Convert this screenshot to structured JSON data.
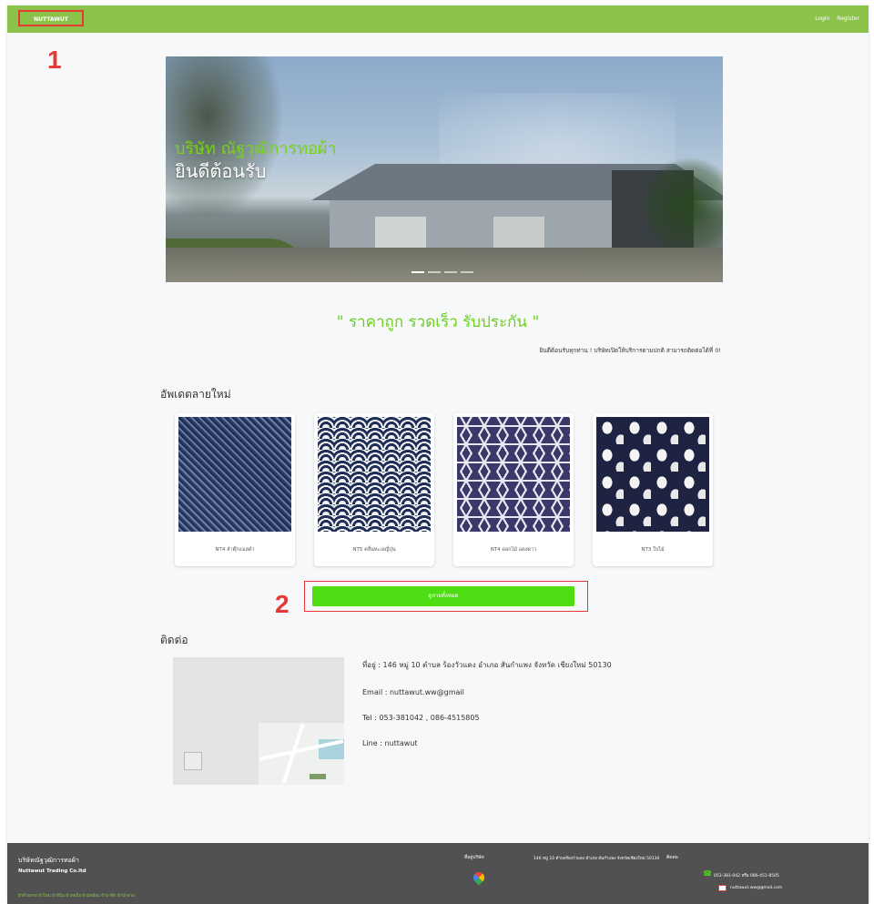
{
  "navbar": {
    "brand": "NUTTAWUT",
    "login": "Login",
    "register": "Register"
  },
  "annotations": {
    "one": "1",
    "two": "2"
  },
  "hero": {
    "subtitle": "บริษัท ณัฐวุฒิการทอผ้า",
    "title": "ยินดีต้อนรับ"
  },
  "tagline": "\" ราคาถูก รวดเร็ว รับประกัน \"",
  "welcome": "ยินดีต้อนรับทุกท่าน ! บริษัทเปิดให้บริการตามปกติ สามารถติดต่อได้ที่ 0!",
  "updates": {
    "title": "อัพเดตลายใหม่",
    "items": [
      {
        "caption": "NT4 ลำตุ๊กแมลดำ"
      },
      {
        "caption": "NT5 คลื่นทะเลญี่ปุ่น"
      },
      {
        "caption": "NT4 ดอกไม้ แดงดาว"
      },
      {
        "caption": "NT3 ใบไม้"
      }
    ]
  },
  "all_button": "ดูลายทั้งหมด",
  "contact": {
    "title": "ติดต่อ",
    "address": "ที่อยู่ : 146 หมู่ 10 ตำบล ร้องวัวแดง อำเภอ สันกำแพง จังหวัด เชียงใหม่ 50130",
    "email": "Email : nuttawut.ww@gmail",
    "tel": "Tel : 053-381042 , 086-4515805",
    "line": "Line : nuttawut"
  },
  "footer": {
    "company_th": "บริษัทณัฐวุฒิการทอผ้า",
    "company_en": "Nuttawut Trading Co.ltd",
    "services": "ผ้าฝ้ายลาย ผ้าไหม ผ้าลินิน ผ้าทอมือ ผ้ามัดย้อม ผ้าบาติก ผ้าปักลาย",
    "map_heading": "ที่อยู่บริษัท",
    "address": "146 หมู่ 10 ตำบลร้องวัวแดง อำเภอ สันกำแพง จังหวัดเชียงใหม่ 50130",
    "contact_heading": "ติดต่อ",
    "phone": "053-381-042 หรือ 086-451-8505",
    "email": "nuttawut.ww@gmail.com"
  },
  "colors": {
    "nav": "#8bc34a",
    "accent": "#4ddd12",
    "tagline": "#6ccf1f",
    "annotation": "#e53935",
    "footer": "#515151"
  }
}
